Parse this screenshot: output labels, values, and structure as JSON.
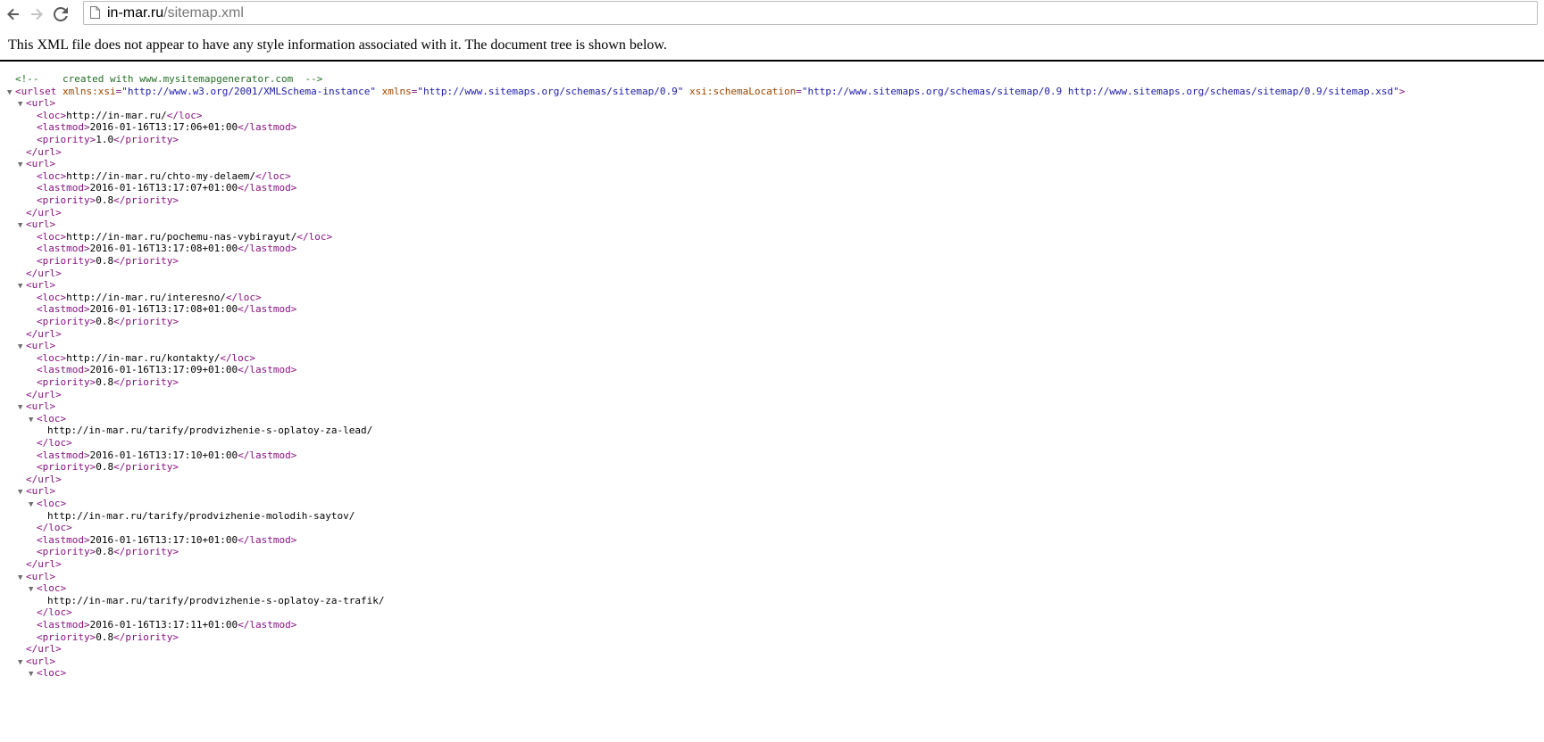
{
  "browser": {
    "url_host": "in-mar.ru",
    "url_path": "/sitemap.xml"
  },
  "page": {
    "notice": "This XML file does not appear to have any style information associated with it. The document tree is shown below."
  },
  "xml": {
    "comment": "<!--    created with www.mysitemapgenerator.com  -->",
    "urlset_open": "<urlset",
    "attr1_name": "xmlns:xsi",
    "attr1_value": "\"http://www.w3.org/2001/XMLSchema-instance\"",
    "attr2_name": "xmlns",
    "attr2_value": "\"http://www.sitemaps.org/schemas/sitemap/0.9\"",
    "attr3_name": "xsi:schemaLocation",
    "attr3_value": "\"http://www.sitemaps.org/schemas/sitemap/0.9 http://www.sitemaps.org/schemas/sitemap/0.9/sitemap.xsd\"",
    "gt": ">",
    "urls": [
      {
        "loc": "http://in-mar.ru/",
        "lastmod": "2016-01-16T13:17:06+01:00",
        "priority": "1.0",
        "block": false
      },
      {
        "loc": "http://in-mar.ru/chto-my-delaem/",
        "lastmod": "2016-01-16T13:17:07+01:00",
        "priority": "0.8",
        "block": false
      },
      {
        "loc": "http://in-mar.ru/pochemu-nas-vybirayut/",
        "lastmod": "2016-01-16T13:17:08+01:00",
        "priority": "0.8",
        "block": false
      },
      {
        "loc": "http://in-mar.ru/interesno/",
        "lastmod": "2016-01-16T13:17:08+01:00",
        "priority": "0.8",
        "block": false
      },
      {
        "loc": "http://in-mar.ru/kontakty/",
        "lastmod": "2016-01-16T13:17:09+01:00",
        "priority": "0.8",
        "block": false
      },
      {
        "loc": "http://in-mar.ru/tarify/prodvizhenie-s-oplatoy-za-lead/",
        "lastmod": "2016-01-16T13:17:10+01:00",
        "priority": "0.8",
        "block": true
      },
      {
        "loc": "http://in-mar.ru/tarify/prodvizhenie-molodih-saytov/",
        "lastmod": "2016-01-16T13:17:10+01:00",
        "priority": "0.8",
        "block": true
      },
      {
        "loc": "http://in-mar.ru/tarify/prodvizhenie-s-oplatoy-za-trafik/",
        "lastmod": "2016-01-16T13:17:11+01:00",
        "priority": "0.8",
        "block": true
      },
      {
        "partial": true
      }
    ]
  },
  "icons": [
    "back-arrow-icon",
    "forward-arrow-icon",
    "reload-icon",
    "page-icon",
    "collapse-triangle-icon"
  ]
}
